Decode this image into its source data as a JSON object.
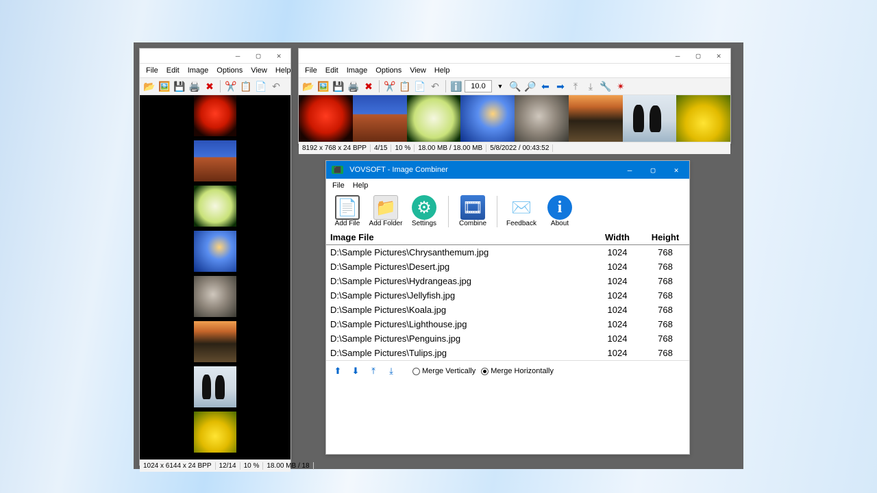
{
  "menus": {
    "file": "File",
    "edit": "Edit",
    "image": "Image",
    "options": "Options",
    "view": "View",
    "help": "Help"
  },
  "viewer1": {
    "status": {
      "dim": "1024 x 6144 x 24 BPP",
      "idx": "12/14",
      "zoom": "10 %",
      "mem": "18.00 MB / 18"
    }
  },
  "viewer2": {
    "zoom_value": "10.0",
    "status": {
      "dim": "8192 x 768 x 24 BPP",
      "idx": "4/15",
      "zoom": "10 %",
      "mem": "18.00 MB / 18.00 MB",
      "date": "5/8/2022 / 00:43:52"
    }
  },
  "thumbs": [
    "flower",
    "desert",
    "hydra",
    "jelly",
    "koala",
    "light",
    "peng",
    "tulip"
  ],
  "combiner": {
    "title": "VOVSOFT - Image Combiner",
    "menus": {
      "file": "File",
      "help": "Help"
    },
    "buttons": {
      "addfile": "Add File",
      "addfolder": "Add Folder",
      "settings": "Settings",
      "combine": "Combine",
      "feedback": "Feedback",
      "about": "About"
    },
    "headers": {
      "file": "Image File",
      "width": "Width",
      "height": "Height"
    },
    "rows": [
      {
        "file": "D:\\Sample Pictures\\Chrysanthemum.jpg",
        "w": "1024",
        "h": "768"
      },
      {
        "file": "D:\\Sample Pictures\\Desert.jpg",
        "w": "1024",
        "h": "768"
      },
      {
        "file": "D:\\Sample Pictures\\Hydrangeas.jpg",
        "w": "1024",
        "h": "768"
      },
      {
        "file": "D:\\Sample Pictures\\Jellyfish.jpg",
        "w": "1024",
        "h": "768"
      },
      {
        "file": "D:\\Sample Pictures\\Koala.jpg",
        "w": "1024",
        "h": "768"
      },
      {
        "file": "D:\\Sample Pictures\\Lighthouse.jpg",
        "w": "1024",
        "h": "768"
      },
      {
        "file": "D:\\Sample Pictures\\Penguins.jpg",
        "w": "1024",
        "h": "768"
      },
      {
        "file": "D:\\Sample Pictures\\Tulips.jpg",
        "w": "1024",
        "h": "768"
      }
    ],
    "merge_v": "Merge Vertically",
    "merge_h": "Merge Horizontally",
    "merge_selected": "h"
  }
}
